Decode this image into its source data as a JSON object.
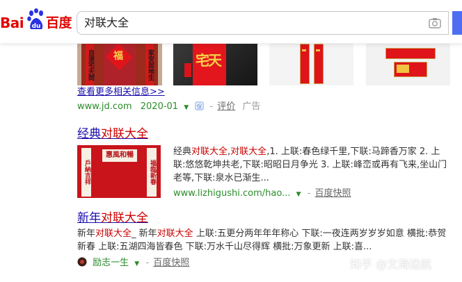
{
  "logo": {
    "left_text": "Bai",
    "paw_text": "du",
    "right_text": "百度"
  },
  "search": {
    "query": "对联大全"
  },
  "image_result": {
    "more_link": "查看更多相关信息>>",
    "url": "www.jd.com",
    "date": "2020-01",
    "review": "评价",
    "ad": "广告",
    "thumb1_text": "福",
    "thumb2_text": "宅天",
    "door_couplet_left": "自道宅天問",
    "door_couplet_right": "家安居地生"
  },
  "results": [
    {
      "title_prefix": "经典",
      "title_highlight": "对联大全",
      "abstract_parts": [
        {
          "t": "经典"
        },
        {
          "t": "对联大全",
          "em": true
        },
        {
          "t": ","
        },
        {
          "t": "对联大全",
          "em": true
        },
        {
          "t": ",1. 上联:春色绿千里,下联:马蹄香万家 2. 上联:悠悠乾坤共老,下联:昭昭日月争光 3. 上联:峰峦或再有飞来,坐山门老等,下联:泉水已渐生..."
        }
      ],
      "url": "www.lizhigushi.com/hao...",
      "snapshot": "百度快照",
      "poster_banner": "惠風和暢",
      "poster_left": "戶納吉祥",
      "poster_right": "福臨新春"
    },
    {
      "title_prefix": "新年",
      "title_highlight": "对联大全",
      "abstract_parts": [
        {
          "t": "新年"
        },
        {
          "t": "对联大全",
          "em": true
        },
        {
          "t": "_ 新年"
        },
        {
          "t": "对联大全",
          "em": true
        },
        {
          "t": " 上联:五更分两年年年称心 下联:一夜连两岁岁岁如意 横批:恭贺新春 上联:五湖四海皆春色 下联:万水千山尽得辉 横批:万象更新 上联:喜..."
        }
      ],
      "source": "励志一生",
      "snapshot": "百度快照"
    }
  ],
  "watermark": "知乎 @文海迷航",
  "colors": {
    "brand_red": "#e10601",
    "brand_blue": "#2932e1",
    "link": "#1a0dab",
    "highlight": "#cc0000",
    "url_green": "#2a8c2a"
  }
}
